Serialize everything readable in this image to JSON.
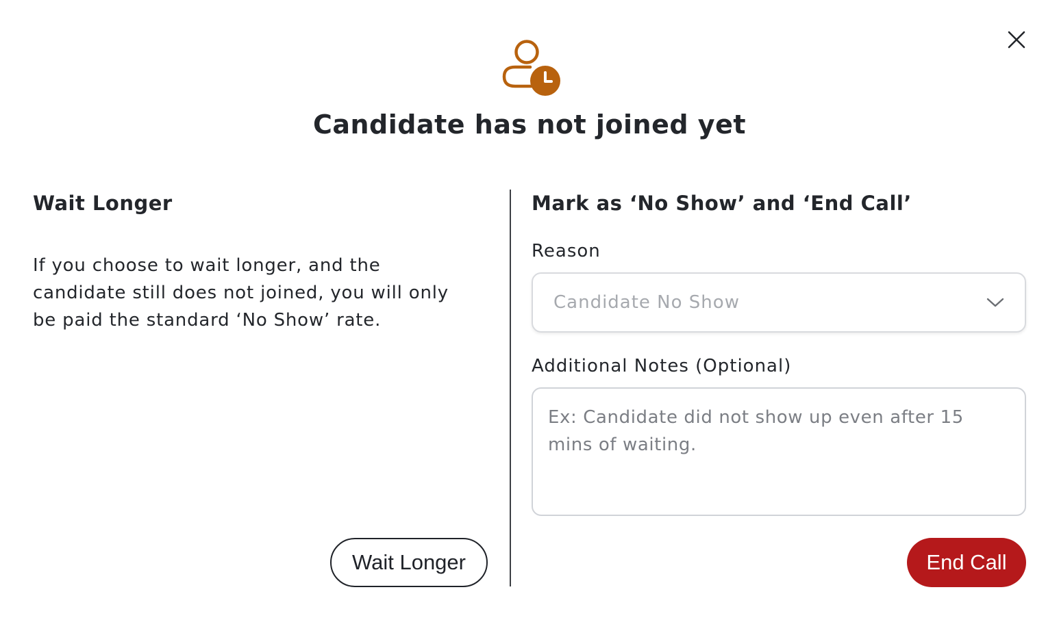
{
  "modal": {
    "title": "Candidate has not joined yet",
    "header_icon": "user-clock-icon",
    "close_icon": "close-icon",
    "accent_color": "#b8620e"
  },
  "wait_section": {
    "heading": "Wait Longer",
    "description": "If you choose to wait longer, and the candidate still does not joined, you will only be paid the standard ‘No Show’ rate.",
    "button_label": "Wait Longer"
  },
  "no_show_section": {
    "heading": "Mark as ‘No Show’ and ‘End Call’",
    "reason_label": "Reason",
    "reason_selected": "Candidate No Show",
    "notes_label": "Additional Notes (Optional)",
    "notes_placeholder": "Ex: Candidate did not show up even after 15 mins of waiting.",
    "notes_value": "",
    "button_label": "End Call",
    "button_color": "#b5191b"
  }
}
